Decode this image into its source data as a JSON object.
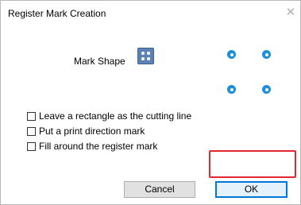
{
  "window": {
    "title": "Register Mark Creation",
    "close_symbol": "✕"
  },
  "mark_shape": {
    "label": "Mark Shape",
    "icon": "register-mark-shape-icon"
  },
  "options": [
    {
      "label": "Leave a rectangle as the cutting line",
      "checked": false
    },
    {
      "label": "Put a print direction mark",
      "checked": false
    },
    {
      "label": "Fill around the register mark",
      "checked": false
    }
  ],
  "buttons": {
    "cancel": "Cancel",
    "ok": "OK"
  },
  "colors": {
    "preview_dot": "#1b8fd8",
    "shape_button": "#5b81b5",
    "highlight": "#e0272e"
  }
}
